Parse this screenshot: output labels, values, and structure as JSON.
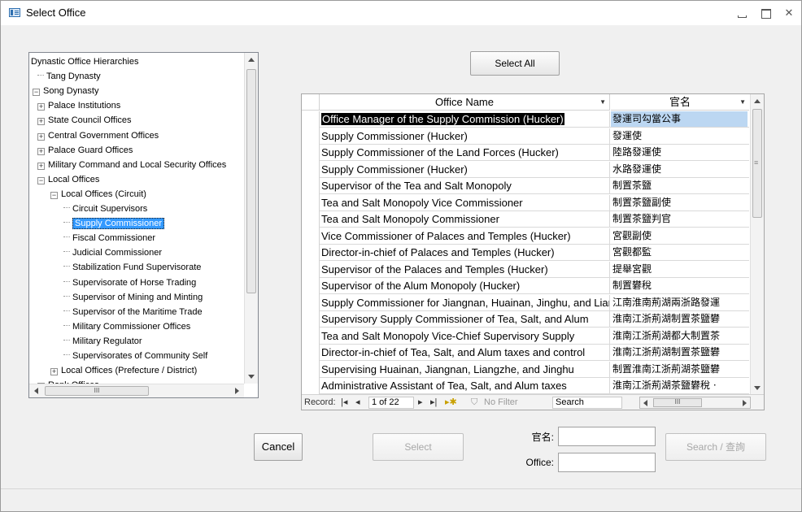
{
  "window": {
    "title": "Select Office",
    "close_glyph": "✕"
  },
  "tree": {
    "items": [
      {
        "label": "Dynastic Office Hierarchies",
        "level": 0,
        "type": "root"
      },
      {
        "label": "Tang Dynasty",
        "level": 1,
        "type": "leaf"
      },
      {
        "label": "Song Dynasty",
        "level": 0,
        "type": "expanded"
      },
      {
        "label": "Palace Institutions",
        "level": 1,
        "type": "collapsed"
      },
      {
        "label": "State Council Offices",
        "level": 1,
        "type": "collapsed"
      },
      {
        "label": "Central Government Offices",
        "level": 1,
        "type": "collapsed"
      },
      {
        "label": "Palace Guard Offices",
        "level": 1,
        "type": "collapsed"
      },
      {
        "label": "Military Command and Local Security Offices",
        "level": 1,
        "type": "collapsed"
      },
      {
        "label": "Local Offices",
        "level": 1,
        "type": "expanded"
      },
      {
        "label": "Local Offices (Circuit)",
        "level": 2,
        "type": "expanded"
      },
      {
        "label": "Circuit Supervisors",
        "level": 3,
        "type": "leaf"
      },
      {
        "label": "Supply Commissioner",
        "level": 3,
        "type": "leaf",
        "selected": true
      },
      {
        "label": "Fiscal Commissioner",
        "level": 3,
        "type": "leaf"
      },
      {
        "label": "Judicial Commissioner",
        "level": 3,
        "type": "leaf"
      },
      {
        "label": "Stabilization Fund Supervisorate",
        "level": 3,
        "type": "leaf"
      },
      {
        "label": "Supervisorate of Horse Trading",
        "level": 3,
        "type": "leaf"
      },
      {
        "label": "Supervisor of Mining and Minting",
        "level": 3,
        "type": "leaf"
      },
      {
        "label": "Supervisor of the Maritime Trade",
        "level": 3,
        "type": "leaf"
      },
      {
        "label": "Military Commissioner Offices",
        "level": 3,
        "type": "leaf"
      },
      {
        "label": "Military Regulator",
        "level": 3,
        "type": "leaf"
      },
      {
        "label": "Supervisorates of Community Self",
        "level": 3,
        "type": "leaf"
      },
      {
        "label": "Local Offices (Prefecture / District)",
        "level": 2,
        "type": "collapsed"
      },
      {
        "label": "Rank Offices",
        "level": 1,
        "type": "collapsed"
      }
    ],
    "hscroll_thumb": "III"
  },
  "buttons": {
    "select_all": "Select All",
    "cancel": "Cancel",
    "select": "Select",
    "search": "Search / 查詢"
  },
  "grid": {
    "columns": {
      "office_name": "Office Name",
      "chinese_name": "官名",
      "dropdown_glyph": "▼"
    },
    "rows": [
      {
        "en": "Office Manager of the Supply Commission (Hucker)",
        "zh": "發運司勾當公事"
      },
      {
        "en": "Supply Commissioner (Hucker)",
        "zh": "發運使"
      },
      {
        "en": "Supply Commissioner of the Land Forces (Hucker)",
        "zh": "陸路發運使"
      },
      {
        "en": "Supply Commissioner (Hucker)",
        "zh": "水路發運使"
      },
      {
        "en": "Supervisor of the Tea and Salt Monopoly",
        "zh": "制置茶鹽"
      },
      {
        "en": "Tea and Salt Monopoly Vice Commissioner",
        "zh": "制置茶鹽副使"
      },
      {
        "en": "Tea and Salt Monopoly Commissioner",
        "zh": "制置茶鹽判官"
      },
      {
        "en": "Vice Commissioner of Palaces and Temples (Hucker)",
        "zh": "宮觀副使"
      },
      {
        "en": "Director-in-chief of Palaces and Temples (Hucker)",
        "zh": "宮觀都監"
      },
      {
        "en": "Supervisor of the Palaces and Temples (Hucker)",
        "zh": "提舉宮觀"
      },
      {
        "en": "Supervisor of the Alum Monopoly (Hucker)",
        "zh": "制置礬稅"
      },
      {
        "en": "Supply Commissioner for Jiangnan, Huainan, Jinghu, and Liangzhe",
        "zh": "江南淮南荊湖兩浙路發運"
      },
      {
        "en": "Supervisory Supply Commissioner of Tea,  Salt, and Alum",
        "zh": "淮南江浙荊湖制置茶鹽礬"
      },
      {
        "en": "Tea and Salt Monopoly  Vice-Chief Supervisory Supply",
        "zh": "淮南江浙荊湖都大制置茶"
      },
      {
        "en": "Director-in-chief of Tea,  Salt, and Alum taxes and control",
        "zh": "淮南江浙荊湖制置茶鹽礬"
      },
      {
        "en": "Supervising Huainan, Jiangnan, Liangzhe, and Jinghu",
        "zh": "制置淮南江浙荊湖茶鹽礬"
      },
      {
        "en": "Administrative Assistant of Tea,  Salt, and Alum taxes",
        "zh": "淮南江浙荊湖茶鹽礬稅 ·"
      }
    ],
    "navigation": {
      "record_label": "Record:",
      "first": "|◂",
      "prev": "◂",
      "position": "1 of 22",
      "next": "▸",
      "last": "▸|",
      "new": "▸✱",
      "filter": "No Filter",
      "search": "Search",
      "hscroll_thumb": "III"
    }
  },
  "fields": {
    "chinese_name_label": "官名:",
    "chinese_name_value": "",
    "office_label": "Office:",
    "office_value": ""
  }
}
